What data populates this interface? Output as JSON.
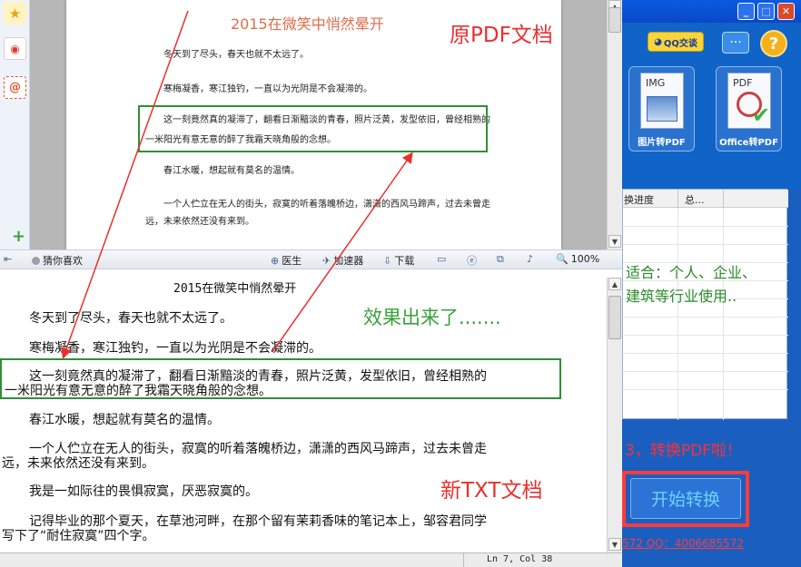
{
  "pdf_viewer": {
    "title": "2015在微笑中悄然晕开",
    "paragraphs": {
      "p1": "冬天到了尽头，春天也就不太远了。",
      "p2": "寒梅凝香，寒江独钓，一直以为光阴是不会凝滞的。",
      "p3a": "这一刻竟然真的凝滞了，翻看日渐黯淡的青春，照片泛黄，发型依旧，曾经相熟的",
      "p3b": "一米阳光有意无意的醉了我霜天晓角般的念想。",
      "p4": "春江水暖，想起就有莫名的温情。",
      "p5a": "一个人伫立在无人的街头，寂寞的听着落魄桥边，潇潇的西风马蹄声，过去未曾走",
      "p5b": "远，未来依然还没有来到。",
      "p6": ""
    }
  },
  "status_bar": {
    "guess": "猜你喜欢",
    "doctor": "医生",
    "accelerator": "加速器",
    "download": "下载",
    "zoom": "100%"
  },
  "notepad": {
    "title": "2015在微笑中悄然晕开",
    "l1": "冬天到了尽头，春天也就不太远了。",
    "l2": "寒梅凝香，寒江独钓，一直以为光阴是不会凝滞的。",
    "l3a": "这一刻竟然真的凝滞了，翻看日渐黯淡的青春，照片泛黄，发型依旧，曾经相熟的",
    "l3b": "一米阳光有意无意的醉了我霜天晓角般的念想。",
    "l4": "春江水暖，想起就有莫名的温情。",
    "l5a": "一个人伫立在无人的街头，寂寞的听着落魄桥边，潇潇的西风马蹄声，过去未曾走",
    "l5b": "远，未来依然还没有来到。",
    "l6": "我是一如际往的畏惧寂寞，厌恶寂寞的。",
    "l7a": "记得毕业的那个夏天，在草池河畔，在那个留有茉莉香味的笔记本上，邹容君同学",
    "l7b": "写下了“耐住寂寞”四个字。",
    "position": "Ln 7, Col 38"
  },
  "app": {
    "qq_button": "QQ交谈",
    "tools": {
      "img": {
        "tag": "IMG",
        "label": "图片转PDF"
      },
      "office": {
        "tag": "PDF",
        "label": "Office转PDF"
      }
    },
    "task_table": {
      "col_progress": "换进度",
      "col_total": "总...",
      "line1": "适合：个人、企业、",
      "line2": "建筑等行业使用.."
    },
    "step3": "3，转换PDF啦！",
    "start_button": "开始转换",
    "qq_contact": "572 QQ：4006685572"
  },
  "annotations": {
    "original_pdf": "原PDF文档",
    "effect": "效果出来了.......",
    "new_txt": "新TXT文档"
  },
  "colors": {
    "annotation_red": "#ea2f2f",
    "annotation_green": "#3aa13a",
    "app_blue": "#1a5fc0"
  }
}
